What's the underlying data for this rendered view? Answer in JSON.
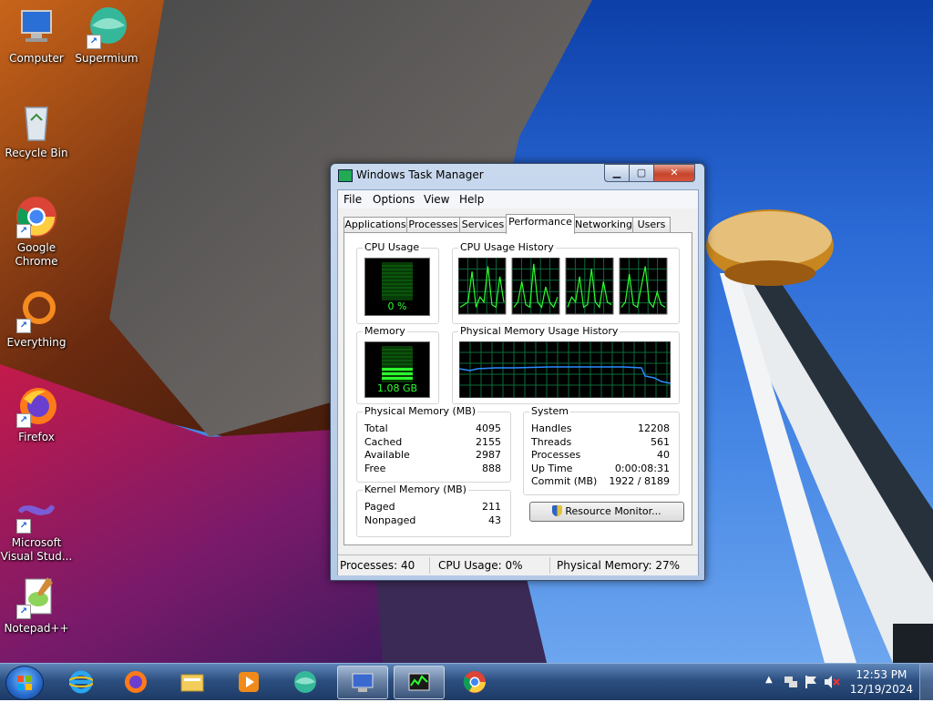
{
  "desktop": {
    "icons": [
      {
        "label": "Computer",
        "icon": "computer-icon"
      },
      {
        "label": "Supermium",
        "icon": "supermium-icon"
      },
      {
        "label": "Recycle Bin",
        "icon": "recycle-bin-icon"
      },
      {
        "label": "Google Chrome",
        "icon": "chrome-icon"
      },
      {
        "label": "Everything",
        "icon": "everything-icon"
      },
      {
        "label": "Firefox",
        "icon": "firefox-icon"
      },
      {
        "label": "Microsoft Visual Stud...",
        "icon": "visual-studio-icon"
      },
      {
        "label": "Notepad++",
        "icon": "notepadpp-icon"
      }
    ]
  },
  "window": {
    "title": "Windows Task Manager",
    "controls": {
      "minimize": "▁",
      "maximize": "▢",
      "close": "✕"
    },
    "menu": [
      "File",
      "Options",
      "View",
      "Help"
    ],
    "tabs": [
      "Applications",
      "Processes",
      "Services",
      "Performance",
      "Networking",
      "Users"
    ],
    "active_tab": "Performance",
    "performance": {
      "cpu_usage_label": "CPU Usage",
      "cpu_usage_value": "0 %",
      "cpu_history_label": "CPU Usage History",
      "memory_label": "Memory",
      "memory_value": "1.08 GB",
      "memory_history_label": "Physical Memory Usage History",
      "physical_memory": {
        "label": "Physical Memory (MB)",
        "rows": [
          {
            "k": "Total",
            "v": "4095"
          },
          {
            "k": "Cached",
            "v": "2155"
          },
          {
            "k": "Available",
            "v": "2987"
          },
          {
            "k": "Free",
            "v": "888"
          }
        ]
      },
      "kernel_memory": {
        "label": "Kernel Memory (MB)",
        "rows": [
          {
            "k": "Paged",
            "v": "211"
          },
          {
            "k": "Nonpaged",
            "v": "43"
          }
        ]
      },
      "system": {
        "label": "System",
        "rows": [
          {
            "k": "Handles",
            "v": "12208"
          },
          {
            "k": "Threads",
            "v": "561"
          },
          {
            "k": "Processes",
            "v": "40"
          },
          {
            "k": "Up Time",
            "v": "0:00:08:31"
          },
          {
            "k": "Commit (MB)",
            "v": "1922 / 8189"
          }
        ]
      },
      "resource_monitor_button": "Resource Monitor..."
    },
    "status": {
      "processes": "Processes: 40",
      "cpu": "CPU Usage: 0%",
      "memory": "Physical Memory: 27%"
    }
  },
  "taskbar": {
    "pinned": [
      "internet-explorer-icon",
      "firefox-icon",
      "explorer-folder-icon",
      "media-player-icon",
      "supermium-icon",
      "remote-desktop-icon",
      "task-manager-icon",
      "chrome-icon"
    ],
    "active": "task-manager-icon",
    "clock_time": "12:53 PM",
    "clock_date": "12/19/2024"
  }
}
